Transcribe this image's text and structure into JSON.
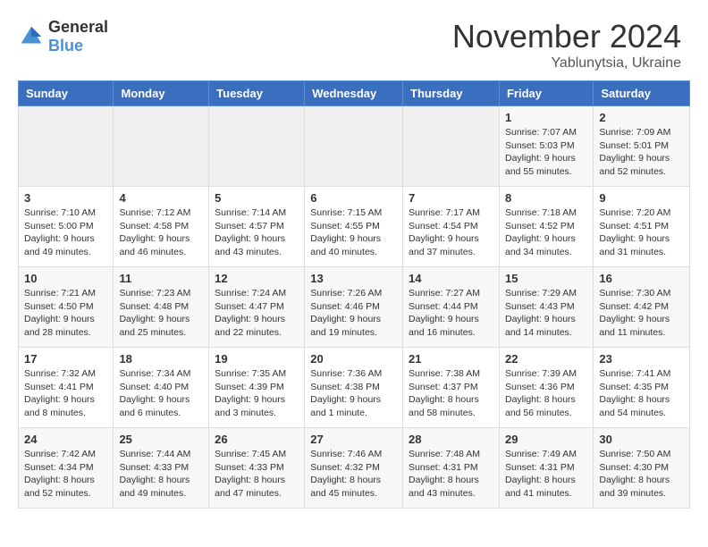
{
  "header": {
    "logo_general": "General",
    "logo_blue": "Blue",
    "month_title": "November 2024",
    "subtitle": "Yablunytsia, Ukraine"
  },
  "calendar": {
    "days_of_week": [
      "Sunday",
      "Monday",
      "Tuesday",
      "Wednesday",
      "Thursday",
      "Friday",
      "Saturday"
    ],
    "weeks": [
      [
        {
          "day": "",
          "info": ""
        },
        {
          "day": "",
          "info": ""
        },
        {
          "day": "",
          "info": ""
        },
        {
          "day": "",
          "info": ""
        },
        {
          "day": "",
          "info": ""
        },
        {
          "day": "1",
          "info": "Sunrise: 7:07 AM\nSunset: 5:03 PM\nDaylight: 9 hours and 55 minutes."
        },
        {
          "day": "2",
          "info": "Sunrise: 7:09 AM\nSunset: 5:01 PM\nDaylight: 9 hours and 52 minutes."
        }
      ],
      [
        {
          "day": "3",
          "info": "Sunrise: 7:10 AM\nSunset: 5:00 PM\nDaylight: 9 hours and 49 minutes."
        },
        {
          "day": "4",
          "info": "Sunrise: 7:12 AM\nSunset: 4:58 PM\nDaylight: 9 hours and 46 minutes."
        },
        {
          "day": "5",
          "info": "Sunrise: 7:14 AM\nSunset: 4:57 PM\nDaylight: 9 hours and 43 minutes."
        },
        {
          "day": "6",
          "info": "Sunrise: 7:15 AM\nSunset: 4:55 PM\nDaylight: 9 hours and 40 minutes."
        },
        {
          "day": "7",
          "info": "Sunrise: 7:17 AM\nSunset: 4:54 PM\nDaylight: 9 hours and 37 minutes."
        },
        {
          "day": "8",
          "info": "Sunrise: 7:18 AM\nSunset: 4:52 PM\nDaylight: 9 hours and 34 minutes."
        },
        {
          "day": "9",
          "info": "Sunrise: 7:20 AM\nSunset: 4:51 PM\nDaylight: 9 hours and 31 minutes."
        }
      ],
      [
        {
          "day": "10",
          "info": "Sunrise: 7:21 AM\nSunset: 4:50 PM\nDaylight: 9 hours and 28 minutes."
        },
        {
          "day": "11",
          "info": "Sunrise: 7:23 AM\nSunset: 4:48 PM\nDaylight: 9 hours and 25 minutes."
        },
        {
          "day": "12",
          "info": "Sunrise: 7:24 AM\nSunset: 4:47 PM\nDaylight: 9 hours and 22 minutes."
        },
        {
          "day": "13",
          "info": "Sunrise: 7:26 AM\nSunset: 4:46 PM\nDaylight: 9 hours and 19 minutes."
        },
        {
          "day": "14",
          "info": "Sunrise: 7:27 AM\nSunset: 4:44 PM\nDaylight: 9 hours and 16 minutes."
        },
        {
          "day": "15",
          "info": "Sunrise: 7:29 AM\nSunset: 4:43 PM\nDaylight: 9 hours and 14 minutes."
        },
        {
          "day": "16",
          "info": "Sunrise: 7:30 AM\nSunset: 4:42 PM\nDaylight: 9 hours and 11 minutes."
        }
      ],
      [
        {
          "day": "17",
          "info": "Sunrise: 7:32 AM\nSunset: 4:41 PM\nDaylight: 9 hours and 8 minutes."
        },
        {
          "day": "18",
          "info": "Sunrise: 7:34 AM\nSunset: 4:40 PM\nDaylight: 9 hours and 6 minutes."
        },
        {
          "day": "19",
          "info": "Sunrise: 7:35 AM\nSunset: 4:39 PM\nDaylight: 9 hours and 3 minutes."
        },
        {
          "day": "20",
          "info": "Sunrise: 7:36 AM\nSunset: 4:38 PM\nDaylight: 9 hours and 1 minute."
        },
        {
          "day": "21",
          "info": "Sunrise: 7:38 AM\nSunset: 4:37 PM\nDaylight: 8 hours and 58 minutes."
        },
        {
          "day": "22",
          "info": "Sunrise: 7:39 AM\nSunset: 4:36 PM\nDaylight: 8 hours and 56 minutes."
        },
        {
          "day": "23",
          "info": "Sunrise: 7:41 AM\nSunset: 4:35 PM\nDaylight: 8 hours and 54 minutes."
        }
      ],
      [
        {
          "day": "24",
          "info": "Sunrise: 7:42 AM\nSunset: 4:34 PM\nDaylight: 8 hours and 52 minutes."
        },
        {
          "day": "25",
          "info": "Sunrise: 7:44 AM\nSunset: 4:33 PM\nDaylight: 8 hours and 49 minutes."
        },
        {
          "day": "26",
          "info": "Sunrise: 7:45 AM\nSunset: 4:33 PM\nDaylight: 8 hours and 47 minutes."
        },
        {
          "day": "27",
          "info": "Sunrise: 7:46 AM\nSunset: 4:32 PM\nDaylight: 8 hours and 45 minutes."
        },
        {
          "day": "28",
          "info": "Sunrise: 7:48 AM\nSunset: 4:31 PM\nDaylight: 8 hours and 43 minutes."
        },
        {
          "day": "29",
          "info": "Sunrise: 7:49 AM\nSunset: 4:31 PM\nDaylight: 8 hours and 41 minutes."
        },
        {
          "day": "30",
          "info": "Sunrise: 7:50 AM\nSunset: 4:30 PM\nDaylight: 8 hours and 39 minutes."
        }
      ]
    ]
  }
}
